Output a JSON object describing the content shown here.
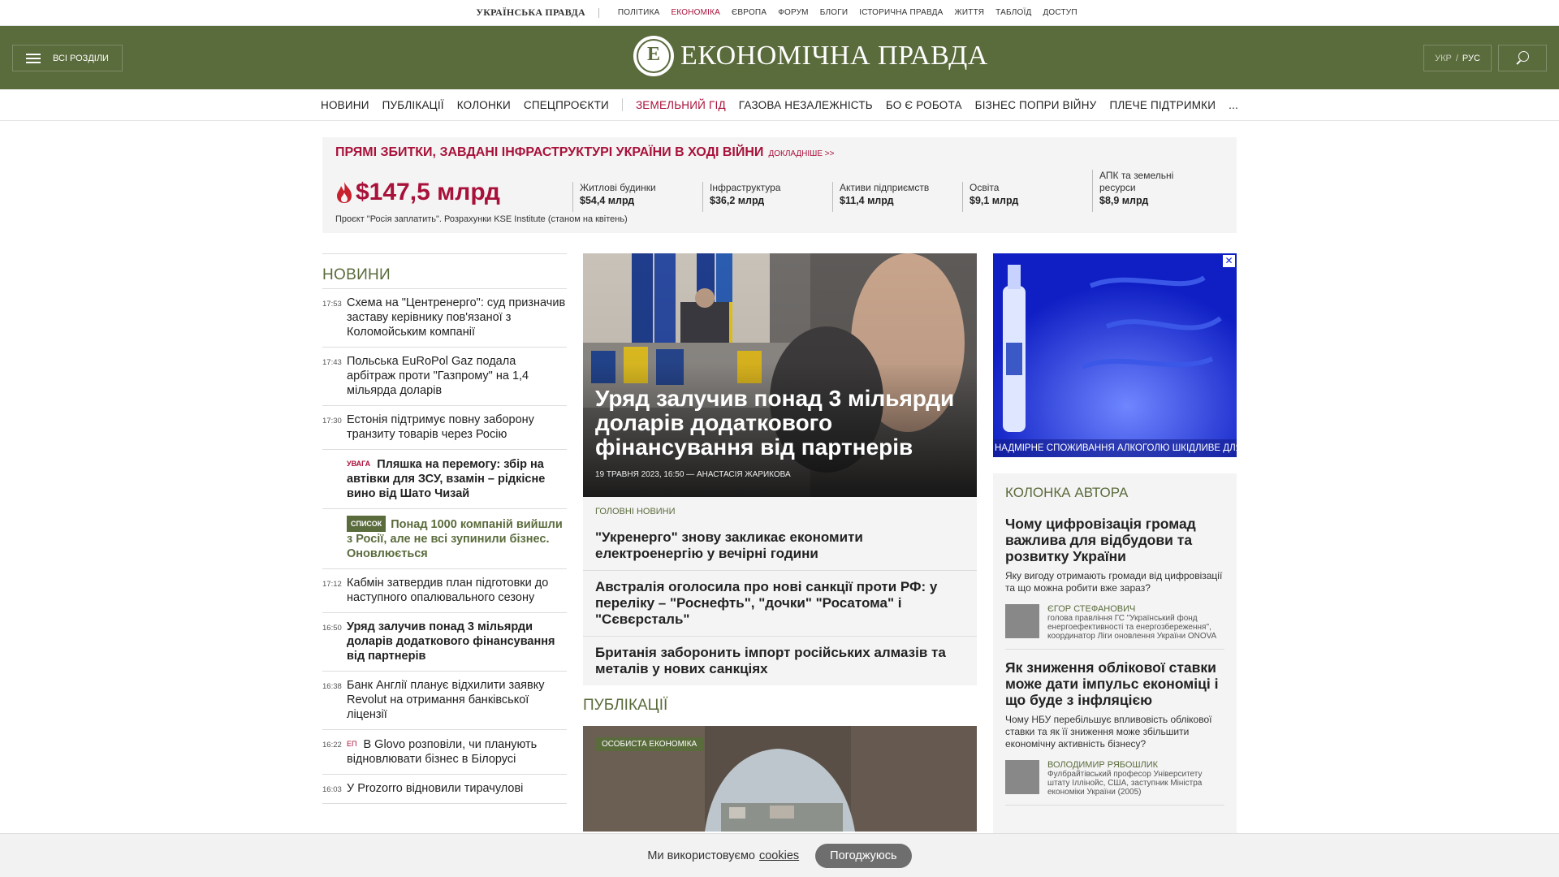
{
  "topbar": {
    "brand": "УКРАЇНСЬКА ПРАВДА",
    "links": [
      "ПОЛІТИКА",
      "ЕКОНОМІКА",
      "ЄВРОПА",
      "ФОРУМ",
      "БЛОГИ",
      "ІСТОРИЧНА ПРАВДА",
      "ЖИТТЯ",
      "ТАБЛОЇД",
      "ДОСТУП"
    ],
    "active_link": "ЕКОНОМІКА"
  },
  "header": {
    "all_sections_label": "ВСІ РОЗДІЛИ",
    "logo_letter": "Е",
    "logo_text": "ЕКОНОМІЧНА ПРАВДА",
    "lang_ukr": "УКР",
    "lang_sep": "/",
    "lang_rus": "РУС",
    "brand_color": "#5a6b3c"
  },
  "nav": {
    "primary": [
      "НОВИНИ",
      "ПУБЛІКАЦІЇ",
      "КОЛОНКИ",
      "СПЕЦПРОЄКТИ"
    ],
    "special": [
      "ЗЕМЕЛЬНИЙ ГІД",
      "ГАЗОВА НЕЗАЛЕЖНІСТЬ",
      "БО Є РОБОТА",
      "БІЗНЕС ПОПРИ ВІЙНУ",
      "ПЛЕЧЕ ПІДТРИМКИ"
    ],
    "more": "...",
    "accent_color": "#a8123a"
  },
  "banner": {
    "title": "ПРЯМІ ЗБИТКИ, ЗАВДАНІ ІНФРАСТРУКТУРІ УКРАЇНИ В ХОДІ ВІЙНИ",
    "more": "ДОКЛАДНІШЕ >>",
    "total": "$147,5 млрд",
    "note": "Проєкт \"Росія заплатить\". Розрахунки KSE Institute (станом на квітень)",
    "stats": [
      {
        "label": "Житлові будинки",
        "value": "$54,4 млрд"
      },
      {
        "label": "Інфраструктура",
        "value": "$36,2 млрд"
      },
      {
        "label": "Активи підприємств",
        "value": "$11,4 млрд"
      },
      {
        "label": "Освіта",
        "value": "$9,1 млрд"
      },
      {
        "label": "АПК та земельні ресурси",
        "value": "$8,9 млрд"
      }
    ]
  },
  "news": {
    "heading": "НОВИНИ",
    "items": [
      {
        "time": "17:53",
        "text": "Схема на \"Центренерго\": суд призначив заставу керівнику пов'язаної з Коломойським компанії"
      },
      {
        "time": "17:43",
        "text": "Польська EuRoPol Gaz подала арбітраж проти \"Газпрому\" на 1,4 мільярда доларів"
      },
      {
        "time": "17:30",
        "text": "Естонія підтримує повну заборону транзиту товарів через Росію"
      },
      {
        "time": "",
        "badge": "УВАГА",
        "text": "Пляшка на перемогу: збір на автівки для ЗСУ, взамін – рідкісне вино від Шато Чизай"
      },
      {
        "time": "",
        "badge": "СПИСОК",
        "text": "Понад 1000 компаній вийшли з Росії, але не всі зупинили бізнес. Оновлюється"
      },
      {
        "time": "17:12",
        "text": "Кабмін затвердив план підготовки до наступного опалювального сезону"
      },
      {
        "time": "16:50",
        "text": "Уряд залучив понад 3 мільярди доларів додаткового фінансування від партнерів"
      },
      {
        "time": "16:38",
        "text": "Банк Англії планує відхилити заявку Revolut на отримання банківської ліцензії"
      },
      {
        "time": "16:22",
        "badge": "ЕП",
        "text": "В Glovo розповіли, чи планують відновлювати бізнес в Білорусі"
      },
      {
        "time": "16:03",
        "text": "У Prozorro відновили тирачулові"
      }
    ]
  },
  "hero": {
    "title": "Уряд залучив понад 3 мільярди доларів додаткового фінансування від партнерів",
    "meta": "19 ТРАВНЯ 2023, 16:50 — АНАСТАСІЯ ЖАРИКОВА"
  },
  "main_news": {
    "heading": "ГОЛОВНІ НОВИНИ",
    "items": [
      "\"Укренерго\" знову закликає економити електроенергію у вечірні години",
      "Австралія оголосила про нові санкції проти РФ: у переліку – \"Роснефть\", \"дочки\" \"Росатома\" і \"Сєвєрсталь\"",
      "Британія заборонить імпорт російських алмазів та металів у нових санкціях"
    ]
  },
  "publications": {
    "heading": "ПУБЛІКАЦІЇ",
    "badge": "ОСОБИСТА ЕКОНОМІКА"
  },
  "ad": {
    "close": "✕",
    "warning": "НАДМІРНЕ СПОЖИВАННЯ АЛКОГОЛЮ ШКІДЛИВЕ ДЛЯ ВАШОГО ЗДОРОВ'Я"
  },
  "columns": {
    "heading": "КОЛОНКА АВТОРА",
    "items": [
      {
        "title": "Чому цифровізація громад важлива для відбудови та розвитку України",
        "lead": "Яку вигоду отримають громади від цифровізації та що можна робити вже зараз?",
        "author": "ЄГОР СТЕФАНОВИЧ",
        "role": "голова правління ГС \"Український фонд енергоефективності та енергозбереження\", координатор Ліги оновлення України ONOVA"
      },
      {
        "title": "Як зниження облікової ставки може дати імпульс економіці і що буде з інфляцією",
        "lead": "Чому НБУ перебільшує впливовість облікової ставки та як її зниження може збільшити економічну активність бізнесу?",
        "author": "ВОЛОДИМИР РЯБОШЛИК",
        "role": "Фулбрайтівський професор Університету штату Іллінойс, США, заступник Міністра економіки України (2005)"
      }
    ]
  },
  "cookie": {
    "text": "Ми використовуємо",
    "link": "cookies",
    "button": "Погоджуюсь"
  }
}
